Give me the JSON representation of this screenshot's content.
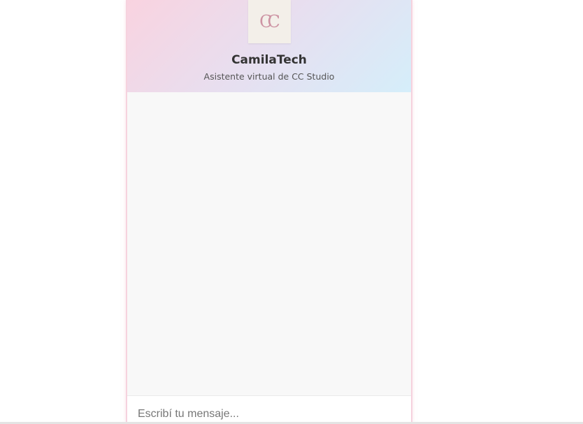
{
  "header": {
    "logo_text": "CC",
    "bot_name": "CamilaTech",
    "subtitle": "Asistente virtual de CC Studio"
  },
  "composer": {
    "placeholder": "Escribí tu mensaje..."
  },
  "colors": {
    "header_gradient_start": "#f9d3e0",
    "header_gradient_end": "#d5eefa",
    "border_accent": "#f6d2de",
    "logo_color": "#c98a9c"
  }
}
